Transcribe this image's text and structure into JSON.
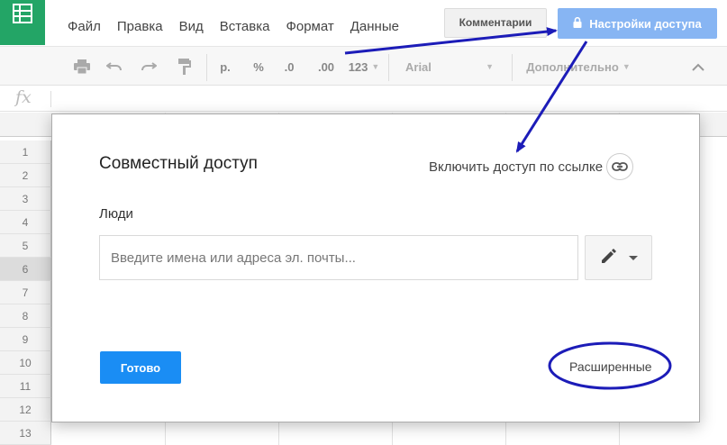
{
  "menu": {
    "items": [
      "Файл",
      "Правка",
      "Вид",
      "Вставка",
      "Формат",
      "Данные"
    ]
  },
  "header": {
    "comments_label": "Комментарии",
    "share_label": "Настройки доступа"
  },
  "toolbar": {
    "currency": "р.",
    "percent": "%",
    "decrease_decimal": ".0",
    "increase_decimal": ".00",
    "number_format": "123",
    "font": "Arial",
    "more": "Дополнительно"
  },
  "formula_bar": {
    "fx_label": "fx"
  },
  "grid": {
    "row_numbers": [
      "1",
      "2",
      "3",
      "4",
      "5",
      "6",
      "7",
      "8",
      "9",
      "10",
      "11",
      "12",
      "13"
    ],
    "selected_row": "6"
  },
  "dialog": {
    "title": "Совместный доступ",
    "link_access_label": "Включить доступ по ссылке",
    "people_label": "Люди",
    "people_placeholder": "Введите имена или адреса эл. почты...",
    "done_label": "Готово",
    "advanced_label": "Расширенные"
  },
  "colors": {
    "sheets_green": "#23a566",
    "share_button": "#87b5f3",
    "done_button": "#1a8df4",
    "annotation_arrow": "#1c1cb8"
  },
  "icons": {
    "logo": "sheets-logo-icon",
    "lock": "lock-icon",
    "link": "link-icon",
    "pencil": "pencil-icon"
  }
}
